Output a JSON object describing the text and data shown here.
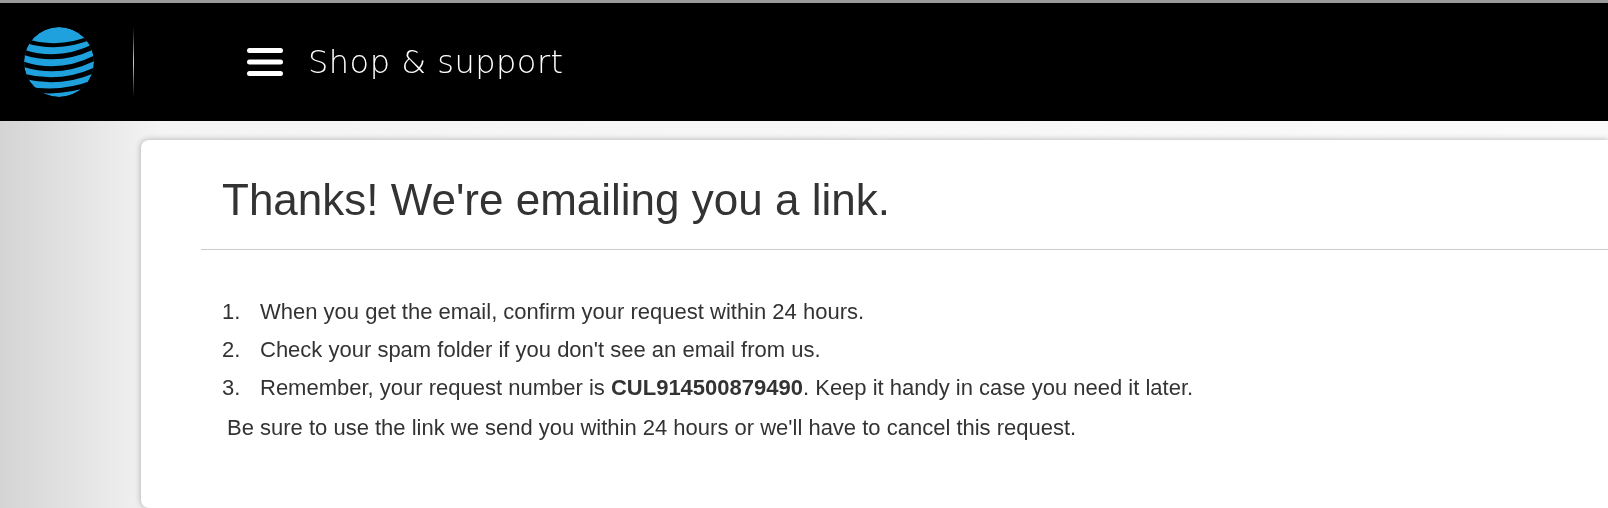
{
  "header": {
    "menu_label": "Shop & support"
  },
  "card": {
    "title": "Thanks! We're emailing you a link.",
    "steps": [
      {
        "number": "1.",
        "text": "When you get the email, confirm your request within 24 hours."
      },
      {
        "number": "2.",
        "text": "Check your spam folder if you don't see an email from us."
      },
      {
        "number": "3.",
        "text": "Remember, your request number is **CUL914500879490**. Keep it handy in case you need it later."
      }
    ],
    "note": "Be sure to use the link we send you within 24 hours or we'll have to cancel this request."
  }
}
